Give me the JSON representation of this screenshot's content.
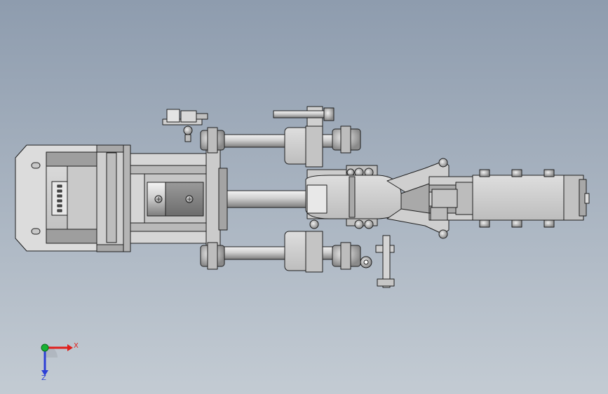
{
  "view": {
    "background_top": "#8e9cae",
    "background_bottom": "#c3cbd3",
    "part_fill": "#d2d2d2",
    "part_shadow": "#8a8a8a",
    "edge_color": "#1e1e1e"
  },
  "triad": {
    "x_label": "X",
    "z_label": "Z",
    "x_color": "#e0201c",
    "z_color": "#2c3fd6",
    "origin_color": "#17b232"
  }
}
